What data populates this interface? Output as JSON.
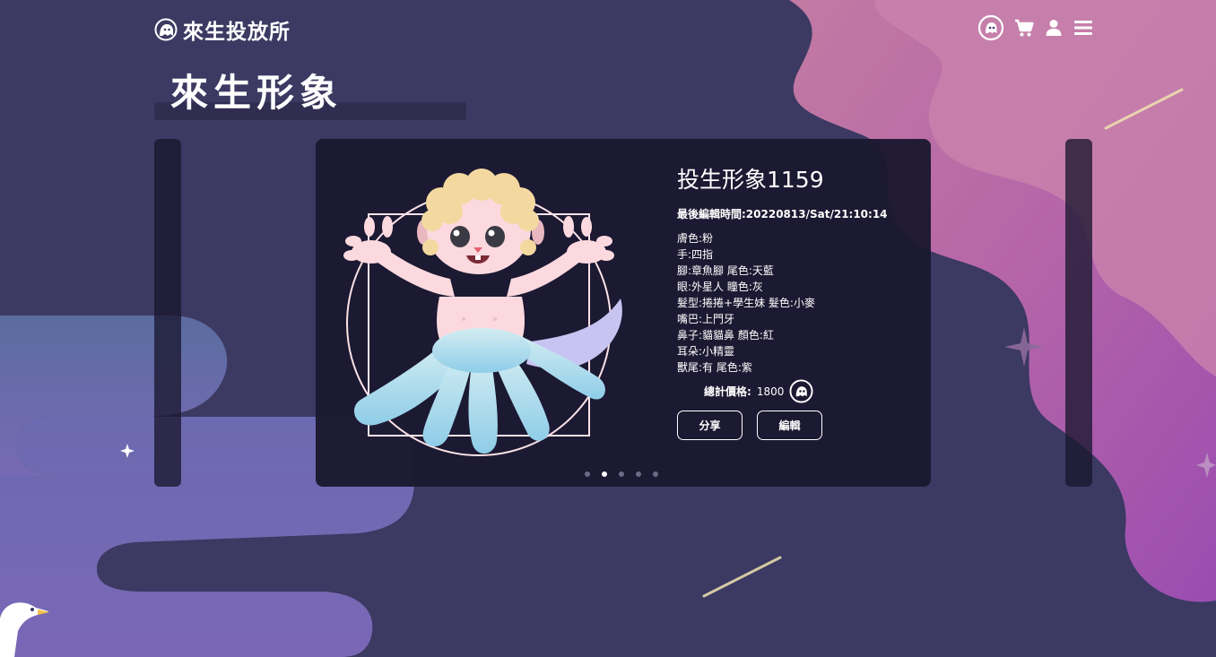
{
  "header": {
    "logo_text": "來生投放所",
    "icons": [
      "ghost-coin-icon",
      "cart-icon",
      "user-icon",
      "menu-icon"
    ]
  },
  "page": {
    "title": "來生形象"
  },
  "card": {
    "name": "投生形象1159",
    "last_edit": "最後編輯時間:20220813/Sat/21:10:14",
    "attributes": [
      "膚色:粉",
      "手:四指",
      "腳:章魚腳  尾色:天藍",
      "眼:外星人  瞳色:灰",
      "髮型:捲捲+學生妹  髮色:小麥",
      "嘴巴:上門牙",
      "鼻子:貓貓鼻  顏色:紅",
      "耳朵:小精靈",
      "獸尾:有  尾色:紫"
    ],
    "price_label": "總計價格:",
    "price_value": "1800",
    "share_label": "分享",
    "edit_label": "編輯"
  },
  "carousel": {
    "slide_count": 5,
    "active_index": 1
  },
  "colors": {
    "background": "#3c3962",
    "card": "#1b1830",
    "pink_cloud": "#c0679e",
    "purple_cloud": "#6e6aa8",
    "skin": "#fcd9df",
    "hair": "#f3d9a0",
    "tentacles": "#9ed7ea"
  }
}
